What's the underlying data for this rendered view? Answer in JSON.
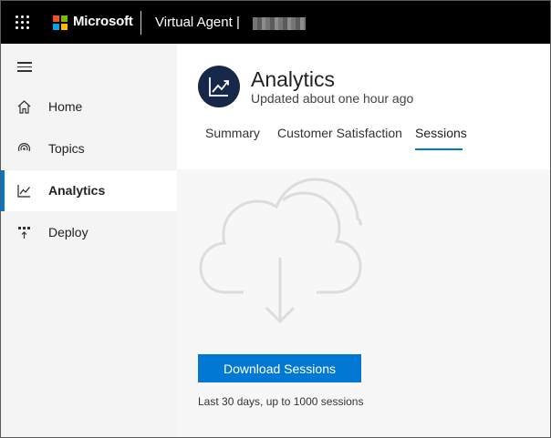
{
  "topbar": {
    "brand": "Microsoft",
    "product": "Virtual Agent |",
    "brand_colors": [
      "#f25022",
      "#7fba00",
      "#00a4ef",
      "#ffb900"
    ]
  },
  "sidebar": {
    "items": [
      {
        "label": "Home",
        "icon": "home-icon",
        "active": false
      },
      {
        "label": "Topics",
        "icon": "topics-icon",
        "active": false
      },
      {
        "label": "Analytics",
        "icon": "analytics-icon",
        "active": true
      },
      {
        "label": "Deploy",
        "icon": "deploy-icon",
        "active": false
      }
    ]
  },
  "page": {
    "title": "Analytics",
    "subtitle": "Updated about one hour ago"
  },
  "tabs": [
    {
      "label": "Summary",
      "active": false
    },
    {
      "label": "Customer Satisfaction",
      "active": false
    },
    {
      "label": "Sessions",
      "active": true
    }
  ],
  "sessions": {
    "download_label": "Download Sessions",
    "note": "Last 30 days, up to 1000 sessions"
  },
  "colors": {
    "accent": "#0078d4",
    "badge": "#17274a",
    "topbar": "#000000"
  }
}
